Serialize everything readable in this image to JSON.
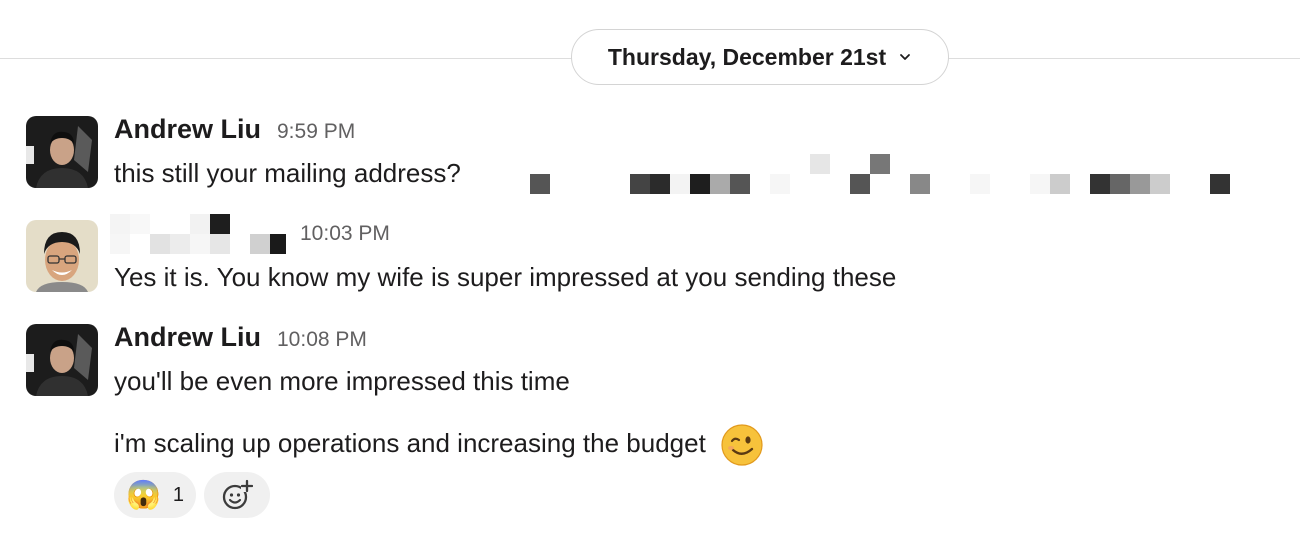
{
  "date_divider": {
    "label": "Thursday, December 21st"
  },
  "messages": [
    {
      "author": "Andrew Liu",
      "time": "9:59 PM",
      "lines": [
        "this still your mailing address?"
      ]
    },
    {
      "author": "",
      "time": "10:03 PM",
      "lines": [
        "Yes it is. You know my wife is super impressed at you sending these"
      ]
    },
    {
      "author": "Andrew Liu",
      "time": "10:08 PM",
      "lines": [
        "you'll be even more impressed this time",
        "i'm scaling up operations and increasing the budget"
      ]
    }
  ],
  "reactions": [
    {
      "emoji": "😱",
      "count": "1"
    }
  ],
  "icons": {
    "date_chevron": "chevron-down-icon",
    "add_reaction": "add-reaction-icon",
    "wink_emoji": "wink-emoji-icon"
  },
  "colors": {
    "text": "#1d1c1d",
    "muted": "#616061",
    "reaction_bg": "#f0f0f0",
    "divider": "#dddddd"
  }
}
